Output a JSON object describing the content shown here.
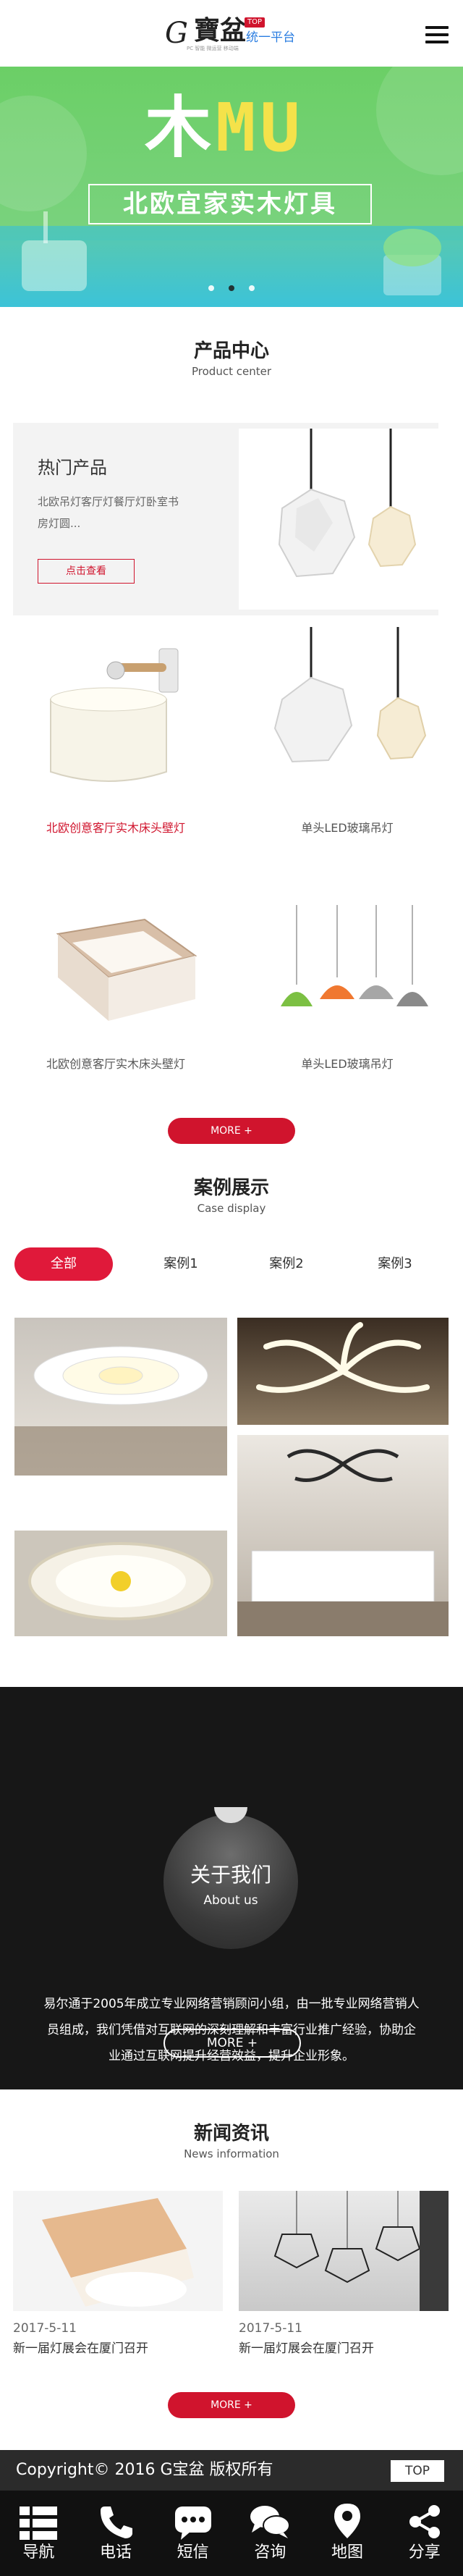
{
  "header": {
    "logo_g": "G",
    "logo_bao": "寶盆",
    "logo_tag": "TOP",
    "logo_slogan": "统一平台",
    "logo_sub": "PC 智能 微运营 移动端"
  },
  "banner": {
    "big_text_1": "木",
    "big_text_2": "MU",
    "title": "北欧宜家实木灯具",
    "slides": 3,
    "active_slide": 2
  },
  "products": {
    "title": "产品中心",
    "subtitle": "Product center",
    "hot": {
      "heading": "热门产品",
      "desc": "北欧吊灯客厅灯餐厅灯卧室书房灯圆...",
      "button": "点击查看"
    },
    "items": [
      {
        "name": "北欧创意客厅实木床头壁灯"
      },
      {
        "name": "单头LED玻璃吊灯"
      },
      {
        "name": "北欧创意客厅实木床头壁灯"
      },
      {
        "name": "单头LED玻璃吊灯"
      }
    ],
    "more": "MORE +"
  },
  "cases": {
    "title": "案例展示",
    "subtitle": "Case display",
    "tabs": [
      "全部",
      "案例1",
      "案例2",
      "案例3"
    ]
  },
  "about": {
    "title": "关于我们",
    "subtitle": "About us",
    "text": "易尔通于2005年成立专业网络营销顾问小组，由一批专业网络营销人员组成，我们凭借对互联网的深刻理解和丰富行业推广经验，协助企业通过互联网提升经营效益，提升企业形象。",
    "more": "MORE +"
  },
  "news": {
    "title": "新闻资讯",
    "subtitle": "News information",
    "items": [
      {
        "date": "2017-5-11",
        "title": "新一届灯展会在厦门召开"
      },
      {
        "date": "2017-5-11",
        "title": "新一届灯展会在厦门召开"
      }
    ],
    "more": "MORE +"
  },
  "footer": {
    "copyright": "Copyright© 2016  G宝盆 版权所有",
    "top": "TOP"
  },
  "nav": [
    {
      "label": "导航",
      "icon": "grid-icon"
    },
    {
      "label": "电话",
      "icon": "phone-icon"
    },
    {
      "label": "短信",
      "icon": "sms-icon"
    },
    {
      "label": "咨询",
      "icon": "chat-icon"
    },
    {
      "label": "地图",
      "icon": "map-pin-icon"
    },
    {
      "label": "分享",
      "icon": "share-icon"
    }
  ],
  "colors": {
    "accent": "#d0142d",
    "footer_bar": "#2b2b2b",
    "nav_bar": "#111111",
    "about_bg": "#171717"
  }
}
